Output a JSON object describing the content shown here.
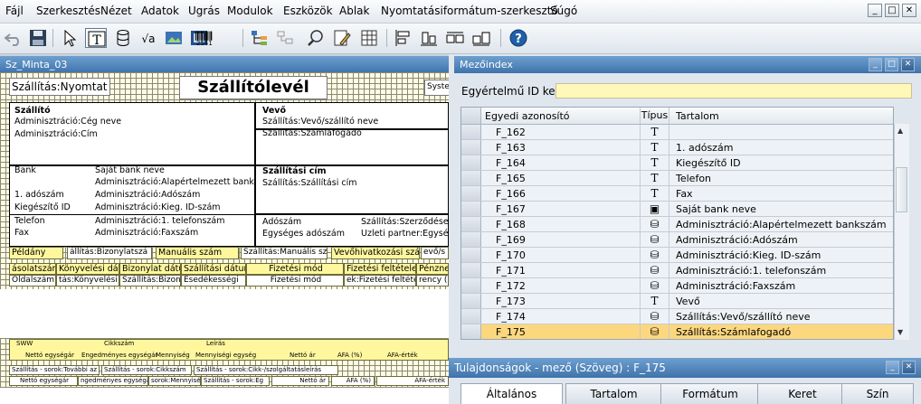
{
  "menu": {
    "items": [
      "Fájl",
      "Szerkesztés",
      "Nézet",
      "Adatok",
      "Ugrás",
      "Modulok",
      "Eszközök",
      "Ablak",
      "Nyomtatásiformátum-szerkesztő",
      "Súgó"
    ]
  },
  "toolbar": {
    "barcode_label": "2541"
  },
  "document": {
    "tab_title": "Sz_Minta_03",
    "top_field": "Szállítás:Nyomtat",
    "title": "Szállítólevél",
    "system_field": "Syste",
    "supplier_header": "Szállító",
    "supplier_name": "Adminisztráció:Cég neve",
    "supplier_address": "Adminisztráció:Cím",
    "customer_header": "Vevő",
    "customer_name": "Szállítás:Vevő/szállító neve",
    "customer_receiver": "Szállítás:Számlafogadó",
    "bank_label": "Bank",
    "bank_value": "Saját bank neve",
    "bank_account": "Adminisztráció:Alapértelmezett banks",
    "tax1_label": "1. adószám",
    "tax1_value": "Adminisztráció:Adószám",
    "extra_id_label": "Kiegészítő ID",
    "extra_id_value": "Adminisztráció:Kieg. ID-szám",
    "phone_label": "Telefon",
    "phone_value": "Adminisztráció:1. telefonszám",
    "fax_label": "Fax",
    "fax_value": "Adminisztráció:Faxszám",
    "shipping_header": "Szállítási cím",
    "shipping_address": "Szállítás:Szállítási cím",
    "taxnum_label": "Adószám",
    "taxnum_value": "Szállítás:Szerződése",
    "group_tax_label": "Egységes adószám",
    "partner_label": "Üzleti partner:Egysé",
    "copy_label": "Példány",
    "doc_number": "állítás:Bizonylatszá",
    "manual_label": "Manuális szám",
    "manual_value": "Szállítás:Manuális szá",
    "customer_ref_label": "Vevőhivatkozási szám",
    "customer_ref_value": "evő/s",
    "col_headers": [
      "ásolatszám",
      "Könyvelési dátum",
      "Bizonylat dátuma",
      "Szállítási dátum",
      "Fizetési mód",
      "Fizetési feltételek",
      "Pénznem"
    ],
    "col_values": [
      "Oldalszám",
      "tás:Könyvelési dátu",
      "Szállítás:Bizonylat dátu",
      "Esedékességi",
      "Fizetési mód",
      "ek:Fizetési feltétel",
      "rency (F"
    ],
    "lines_headers_1": [
      "SWW",
      "Cikkszám",
      "Leírás"
    ],
    "lines_headers_2": [
      "Nettó egységár",
      "Engedményes egységár",
      "Mennyiség",
      "Mennyiségi egység",
      "Nettó ár",
      "ÁFA (%)",
      "ÁFA-érték"
    ],
    "lines_values_1": [
      "Szállítás - sorok:További az",
      "Szállítás - sorok:Cikkszám",
      "Szállítás - sorok:Cikk-/szolgáltatásleírás"
    ],
    "lines_values_2": [
      "Nettó egységár",
      "ngedményes egységár",
      "sorok:Mennyiség",
      "Szállítás - sorok:Eg",
      "Nettó ár",
      "ÁFA (%)",
      "ÁFA-érték"
    ]
  },
  "field_index": {
    "title": "Mezőindex",
    "unique_id_label": "Egyértelmű ID ke",
    "unique_id_value": "",
    "headers": {
      "id": "Egyedi azonosító",
      "type": "Típus",
      "content": "Tartalom"
    },
    "rows": [
      {
        "id": "F_162",
        "type": "T",
        "content": ""
      },
      {
        "id": "F_163",
        "type": "T",
        "content": "1. adószám"
      },
      {
        "id": "F_164",
        "type": "T",
        "content": "Kiegészítő ID"
      },
      {
        "id": "F_165",
        "type": "T",
        "content": "Telefon"
      },
      {
        "id": "F_166",
        "type": "T",
        "content": "Fax"
      },
      {
        "id": "F_167",
        "type": "▣",
        "content": "Saját bank neve"
      },
      {
        "id": "F_168",
        "type": "⛁",
        "content": "Adminisztráció:Alapértelmezett bankszám"
      },
      {
        "id": "F_169",
        "type": "⛁",
        "content": "Adminisztráció:Adószám"
      },
      {
        "id": "F_170",
        "type": "⛁",
        "content": "Adminisztráció:Kieg. ID-szám"
      },
      {
        "id": "F_171",
        "type": "⛁",
        "content": "Adminisztráció:1. telefonszám"
      },
      {
        "id": "F_172",
        "type": "⛁",
        "content": "Adminisztráció:Faxszám"
      },
      {
        "id": "F_173",
        "type": "T",
        "content": "Vevő"
      },
      {
        "id": "F_174",
        "type": "⛁",
        "content": "Szállítás:Vevő/szállító neve"
      },
      {
        "id": "F_175",
        "type": "⛁",
        "content": "Szállítás:Számlafogadó"
      }
    ],
    "selected_id": "F_175"
  },
  "properties": {
    "title": "Tulajdonságok - mező (Szöveg) : F_175",
    "tabs": [
      "Általános",
      "Tartalom",
      "Formátum",
      "Keret",
      "Szín"
    ]
  },
  "colors": {
    "title_bar": "#3e73ab",
    "selected_row": "#fcd77e",
    "field_yellow": "#fff79e"
  }
}
